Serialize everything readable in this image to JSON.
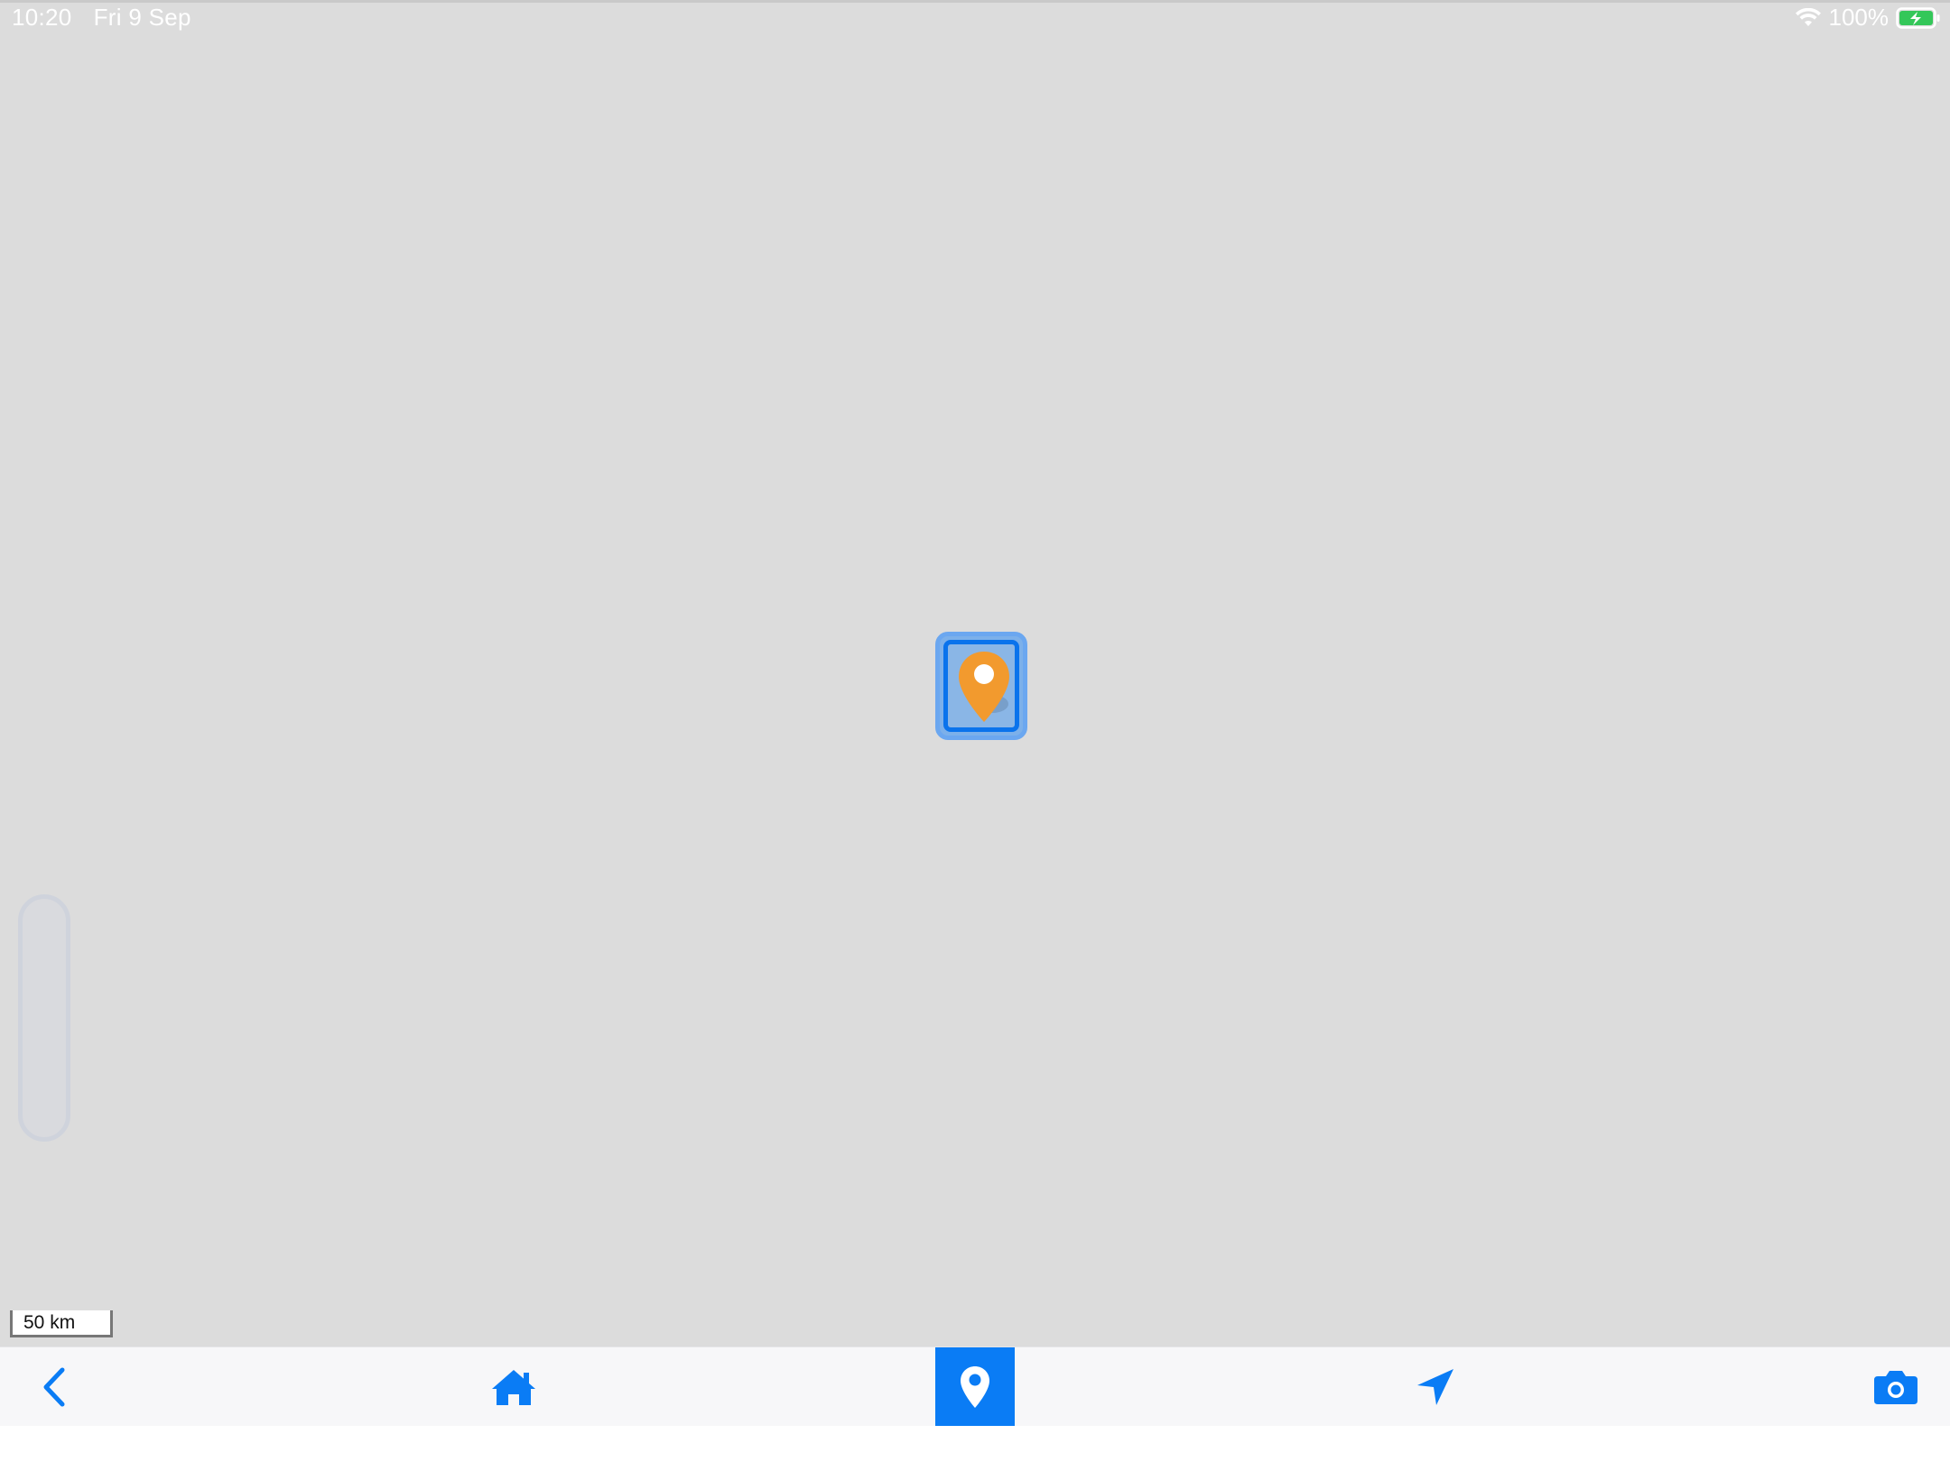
{
  "status_bar": {
    "time": "10:20",
    "date": "Fri 9 Sep",
    "battery_percent": "100%",
    "icons": [
      "wifi-icon",
      "battery-charging-icon"
    ]
  },
  "map": {
    "scale_label": "50 km",
    "marker_icon": "map-pin-icon",
    "marker_color": "#f29a2e",
    "selection_color": "#0a73ec"
  },
  "toolbar": {
    "accent_color": "#0a7cf5",
    "buttons": [
      {
        "name": "back",
        "icon": "chevron-left-icon"
      },
      {
        "name": "home",
        "icon": "home-icon"
      },
      {
        "name": "pin",
        "icon": "map-pin-icon",
        "selected": true
      },
      {
        "name": "navigate",
        "icon": "location-arrow-icon"
      },
      {
        "name": "camera",
        "icon": "camera-icon"
      }
    ]
  }
}
